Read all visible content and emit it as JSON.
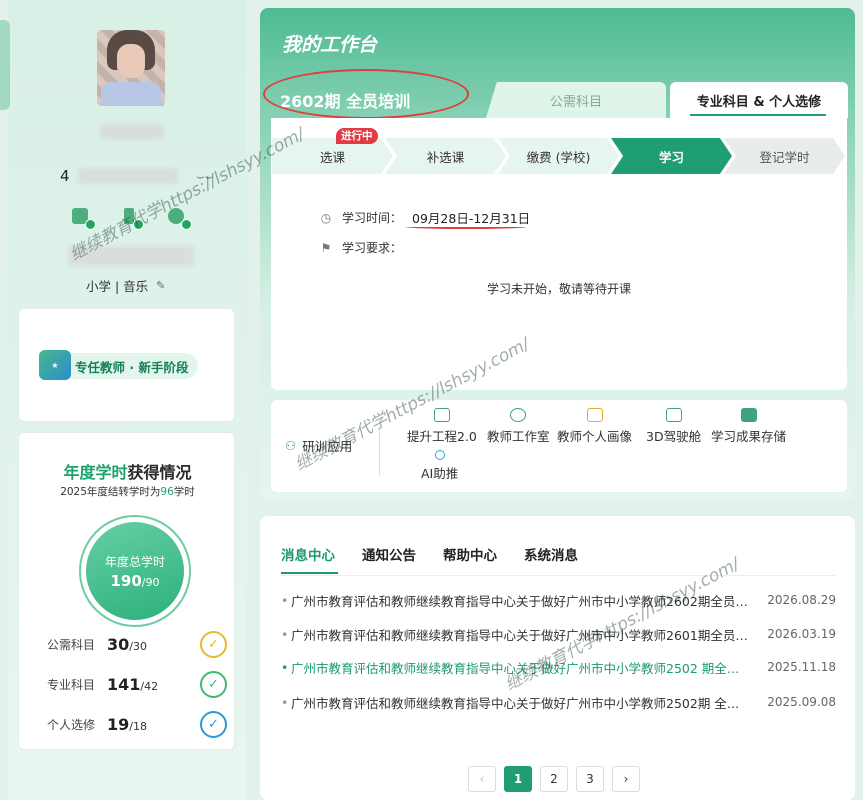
{
  "profile": {
    "id_prefix": "4",
    "subject": "小学 | 音乐",
    "stage_badge": "专任教师 · 新手阶段"
  },
  "hours": {
    "title_prefix": "年度学时",
    "title_suffix": "获得情况",
    "subtitle_prefix": "2025年度结转学时为",
    "subtitle_value": "96",
    "subtitle_suffix": "学时",
    "total_label": "年度总学时",
    "total_value": "190",
    "total_max": "/90",
    "items": [
      {
        "label": "公需科目",
        "value": "30",
        "max": "/30",
        "color": "#e5b92b"
      },
      {
        "label": "专业科目",
        "value": "141",
        "max": "/42",
        "color": "#3dba71"
      },
      {
        "label": "个人选修",
        "value": "19",
        "max": "/18",
        "color": "#2f97d8"
      }
    ]
  },
  "workbench": {
    "title": "我的工作台",
    "period": "2602期  全员培训",
    "tabs": [
      {
        "label": "公需科目"
      },
      {
        "label": "专业科目 & 个人选修"
      }
    ],
    "ongoing_tag": "进行中",
    "steps": [
      "选课",
      "补选课",
      "缴费 (学校)",
      "学习",
      "登记学时"
    ],
    "study_time_label": "学习时间：",
    "study_time_value": "09月28日-12月31日",
    "requirement_label": "学习要求：",
    "notice": "学习未开始，敬请等待开课"
  },
  "tools": {
    "research_label": "研训应用",
    "items": [
      "提升工程2.0",
      "教师工作室",
      "教师个人画像",
      "3D驾驶舱",
      "学习成果存储",
      "AI助推"
    ]
  },
  "messages": {
    "tabs": [
      "消息中心",
      "通知公告",
      "帮助中心",
      "系统消息"
    ],
    "items": [
      {
        "text": "广州市教育评估和教师继续教育指导中心关于做好广州市中小学教师2602期全员…",
        "date": "2026.08.29"
      },
      {
        "text": "广州市教育评估和教师继续教育指导中心关于做好广州市中小学教师2601期全员…",
        "date": "2026.03.19"
      },
      {
        "text": "广州市教育评估和教师继续教育指导中心关于做好广州市中小学教师2502 期全…",
        "date": "2025.11.18"
      },
      {
        "text": "广州市教育评估和教师继续教育指导中心关于做好广州市中小学教师2502期 全…",
        "date": "2025.09.08"
      }
    ],
    "pages": [
      "1",
      "2",
      "3"
    ]
  },
  "watermark": "继续教育代学https://lshsyy.com/",
  "icons": {
    "eye": "eye-closed-icon",
    "edit": "edit-icon",
    "clock": "clock-icon",
    "flag": "flag-icon",
    "check": "check-circle-icon",
    "prev": "chevron-left-icon",
    "next": "chevron-right-icon"
  },
  "colors": {
    "brand": "#1f9d74",
    "alert": "#e33a45"
  }
}
